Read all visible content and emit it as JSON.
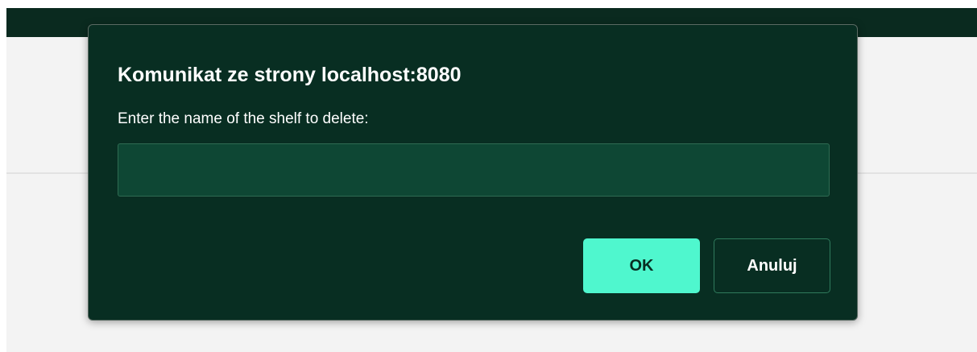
{
  "dialog": {
    "title": "Komunikat ze strony localhost:8080",
    "message": "Enter the name of the shelf to delete:",
    "input_value": "",
    "input_placeholder": "",
    "ok_label": "OK",
    "cancel_label": "Anuluj"
  },
  "colors": {
    "dialog_background": "#082e22",
    "input_background": "#0e4734",
    "ok_button": "#4ff7ce",
    "page_header": "#0a2a1f",
    "page_background": "#f3f3f3"
  }
}
